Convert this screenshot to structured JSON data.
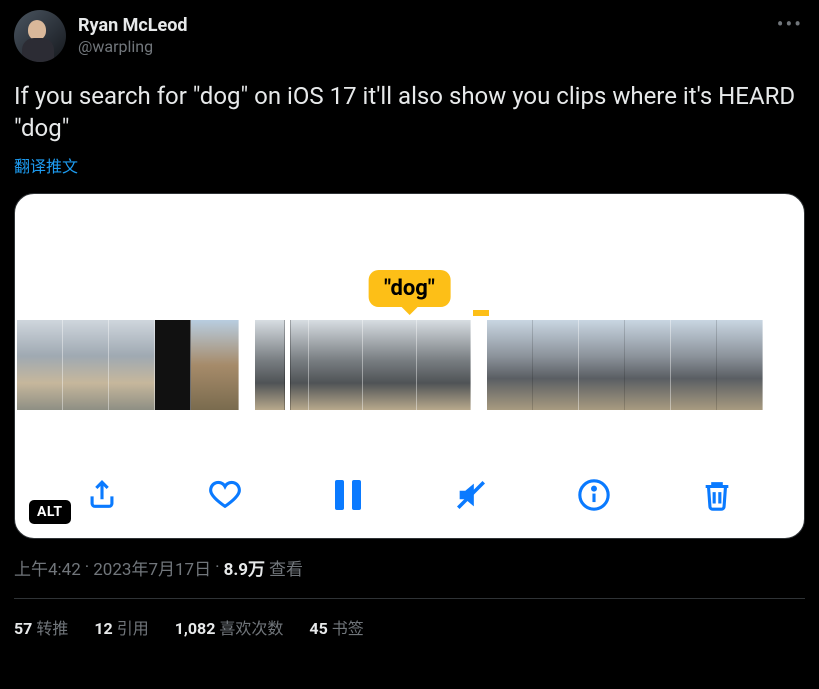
{
  "author": {
    "display_name": "Ryan McLeod",
    "handle": "@warpling"
  },
  "tweet_text": "If you search for \"dog\" on iOS 17 it'll also show you clips where it's HEARD \"dog\"",
  "translate_label": "翻译推文",
  "media": {
    "bubble_text": "\"dog\"",
    "alt_badge": "ALT"
  },
  "meta": {
    "time": "上午4:42",
    "dot1": " · ",
    "date": "2023年7月17日",
    "dot2": " · ",
    "views_count": "8.9万",
    "views_label": " 查看"
  },
  "stats": {
    "retweets_n": "57",
    "retweets_l": "转推",
    "quotes_n": "12",
    "quotes_l": "引用",
    "likes_n": "1,082",
    "likes_l": "喜欢次数",
    "bookmarks_n": "45",
    "bookmarks_l": "书签"
  }
}
